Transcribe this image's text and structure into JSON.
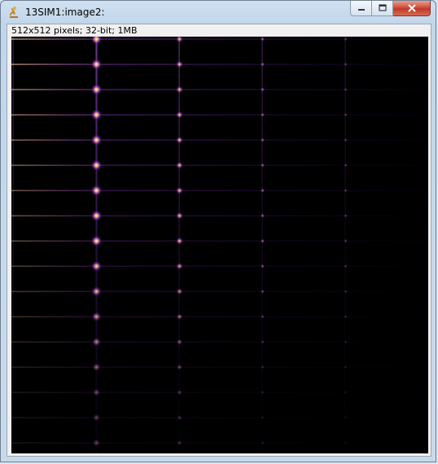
{
  "window": {
    "title": "13SIM1:image2:",
    "app_icon": "imagej-microscope-icon",
    "buttons": {
      "minimize": "minimize-icon",
      "maximize": "maximize-icon",
      "close": "close-icon"
    }
  },
  "image": {
    "info": "512x512 pixels; 32-bit; 1MB",
    "lut": "fire",
    "colors": {
      "background": "#000000",
      "peak": "#ffffff",
      "glow": "#ffb060",
      "mid": "#b040ff",
      "low": "#3010a0"
    }
  }
}
